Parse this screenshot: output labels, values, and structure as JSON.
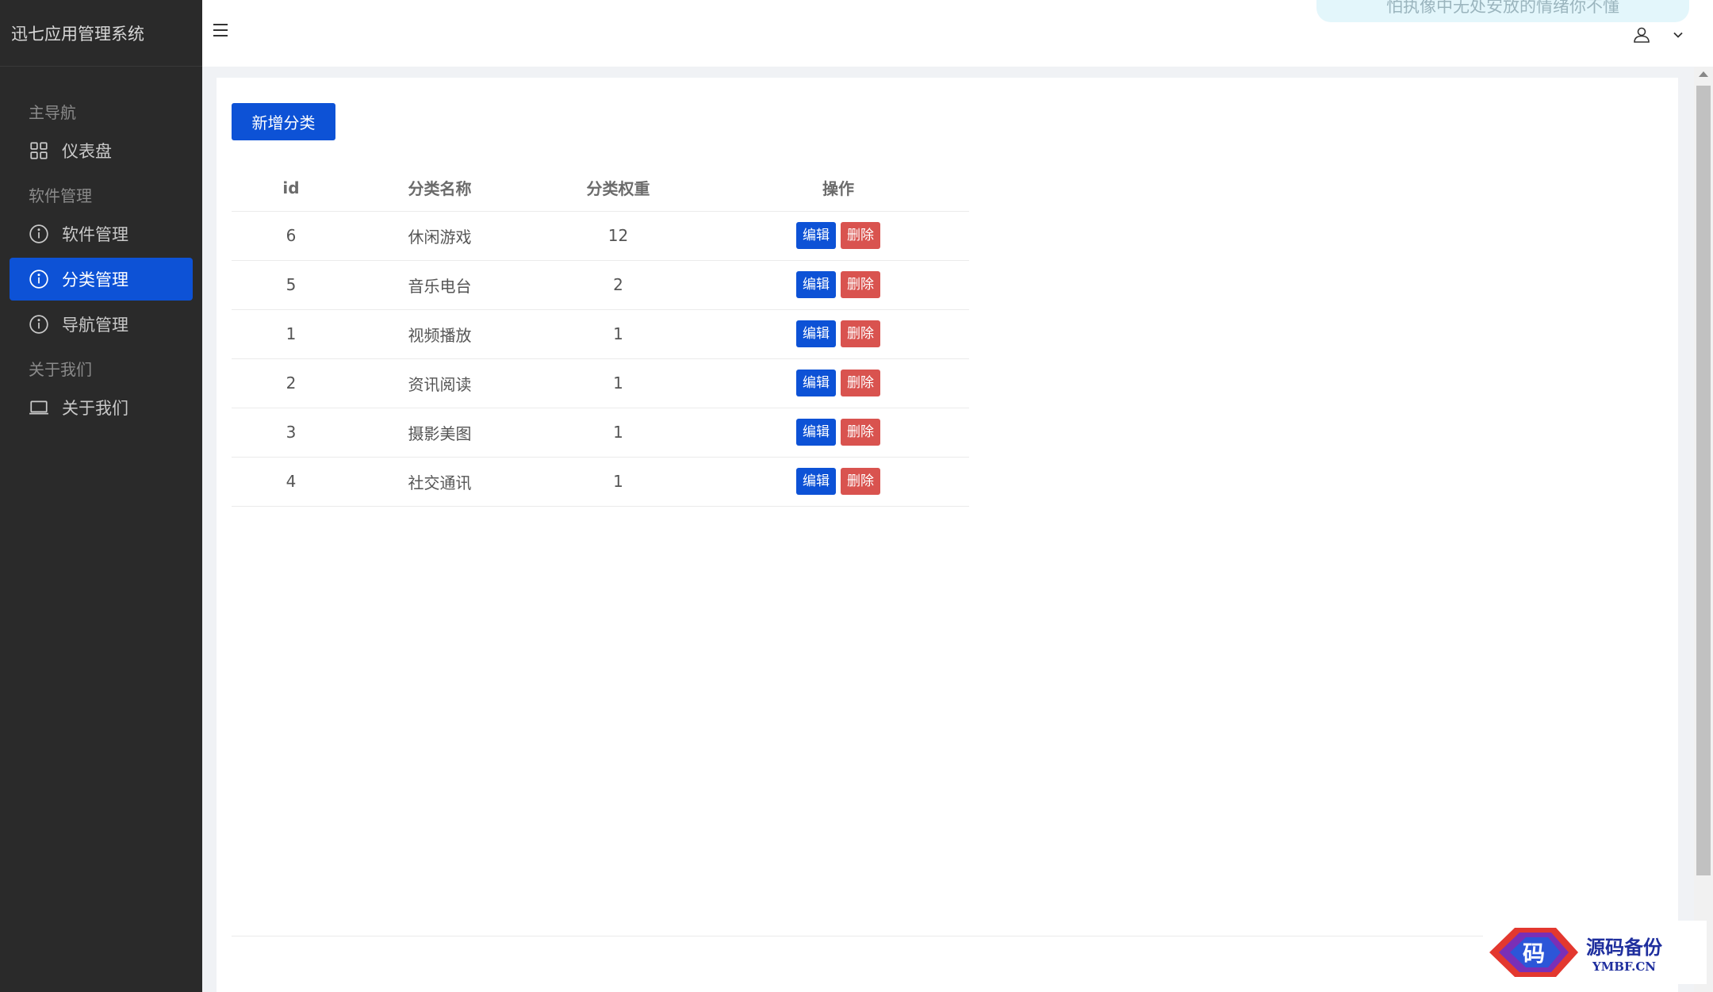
{
  "app": {
    "title": "迅七应用管理系统"
  },
  "header": {
    "notice_text": "怕执像中无处安放的情绪你不懂"
  },
  "sidebar": {
    "groups": [
      {
        "label": "主导航",
        "items": [
          {
            "label": "仪表盘",
            "icon": "dashboard-grid-icon"
          }
        ]
      },
      {
        "label": "软件管理",
        "items": [
          {
            "label": "软件管理",
            "icon": "info-circle-icon"
          },
          {
            "label": "分类管理",
            "icon": "info-circle-icon",
            "active": true
          },
          {
            "label": "导航管理",
            "icon": "info-circle-icon"
          }
        ]
      },
      {
        "label": "关于我们",
        "items": [
          {
            "label": "关于我们",
            "icon": "laptop-icon"
          }
        ]
      }
    ]
  },
  "toolbar": {
    "add_label": "新增分类"
  },
  "table": {
    "headers": {
      "id": "id",
      "name": "分类名称",
      "weight": "分类权重",
      "actions": "操作"
    },
    "edit_label": "编辑",
    "delete_label": "删除",
    "rows": [
      {
        "id": "6",
        "name": "休闲游戏",
        "weight": "12"
      },
      {
        "id": "5",
        "name": "音乐电台",
        "weight": "2"
      },
      {
        "id": "1",
        "name": "视频播放",
        "weight": "1"
      },
      {
        "id": "2",
        "name": "资讯阅读",
        "weight": "1"
      },
      {
        "id": "3",
        "name": "摄影美图",
        "weight": "1"
      },
      {
        "id": "4",
        "name": "社交通讯",
        "weight": "1"
      }
    ]
  },
  "watermark": {
    "logo_char": "码",
    "title": "源码备份",
    "subtitle": "YMBF.CN"
  },
  "colors": {
    "sidebar_bg": "#2a2a2a",
    "accent": "#0d52d6",
    "danger": "#d9534f"
  }
}
